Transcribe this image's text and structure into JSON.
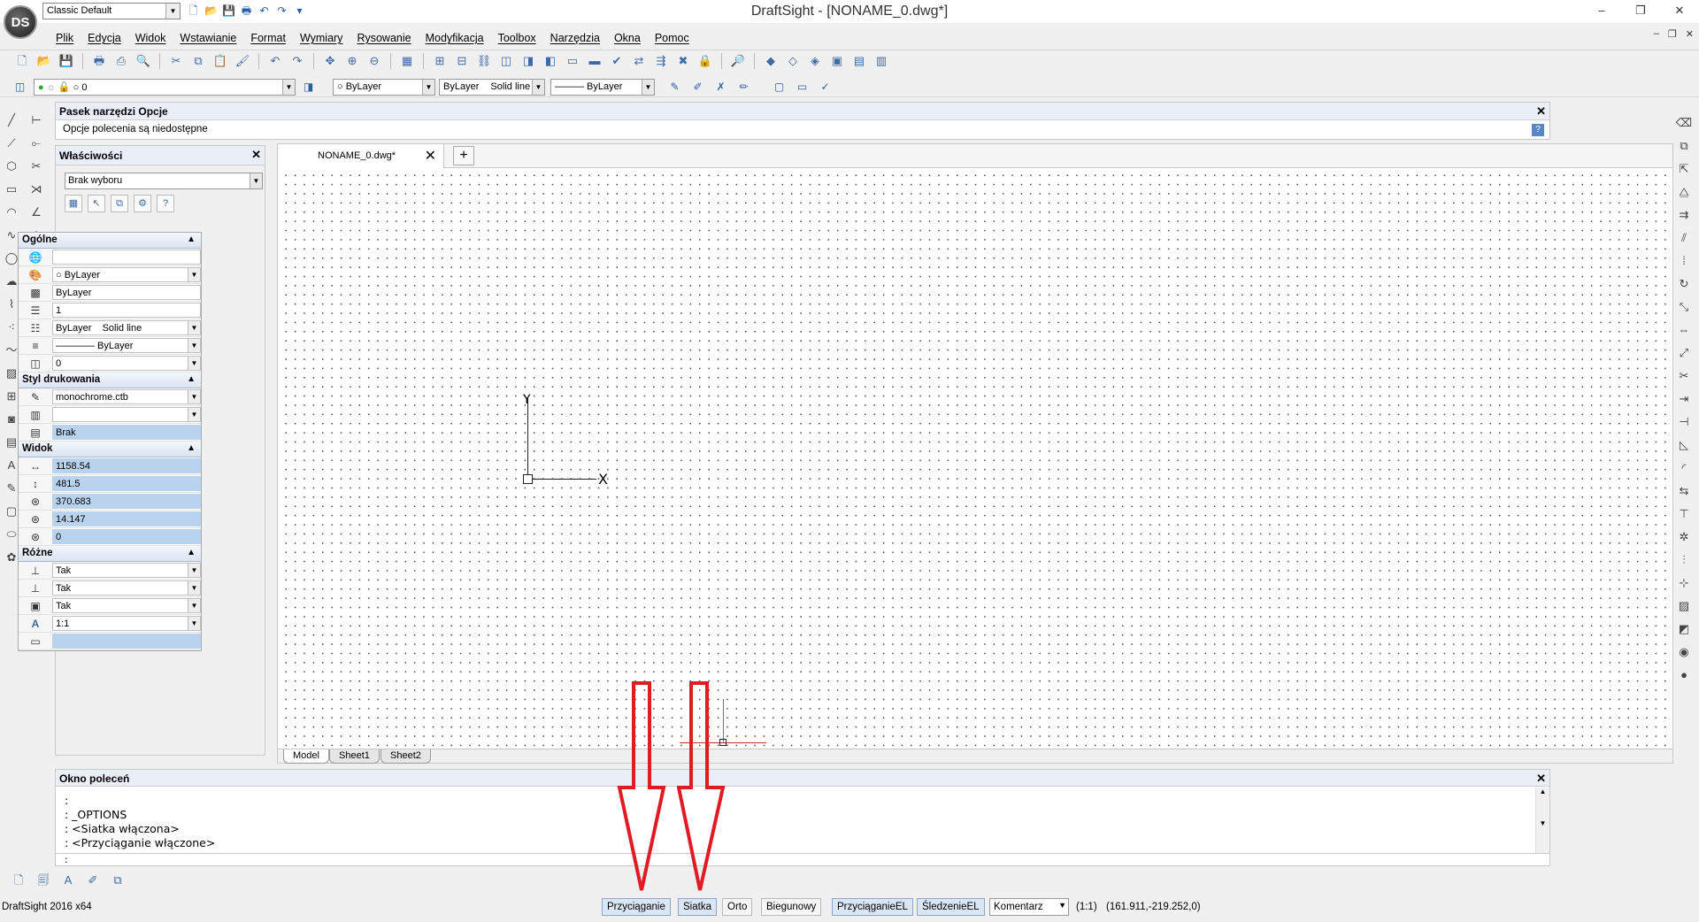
{
  "window": {
    "title": "DraftSight - [NONAME_0.dwg*]",
    "workspace": "Classic Default",
    "logo": "DS"
  },
  "window_controls": {
    "minimize": "–",
    "restore": "❐",
    "close": "✕"
  },
  "menu": [
    "Plik",
    "Edycja",
    "Widok",
    "Wstawianie",
    "Format",
    "Wymiary",
    "Rysowanie",
    "Modyfikacja",
    "Toolbox",
    "Narzędzia",
    "Okna",
    "Pomoc"
  ],
  "layer_toolbar": {
    "layer_name": "0",
    "color": "ByLayer",
    "linestyle_name": "ByLayer",
    "linestyle_desc": "Solid line",
    "lineweight": "——— ByLayer"
  },
  "options_bar": {
    "title": "Pasek narzędzi Opcje",
    "message": "Opcje polecenia są niedostępne"
  },
  "properties": {
    "title": "Właściwości",
    "selection": "Brak wyboru",
    "sections": {
      "general": {
        "title": "Ogólne",
        "color": "ByLayer",
        "color_text": "ByLayer",
        "scale": "1",
        "linestyle_name": "ByLayer",
        "linestyle_desc": "Solid line",
        "lineweight": "———— ByLayer",
        "layer": "0"
      },
      "print_style": {
        "title": "Styl drukowania",
        "table": "monochrome.ctb",
        "style": "Brak"
      },
      "view": {
        "title": "Widok",
        "values": [
          "1158.54",
          "481.5",
          "370.683",
          "14.147",
          "0"
        ]
      },
      "misc": {
        "title": "Różne",
        "values": [
          "Tak",
          "Tak",
          "Tak",
          "1:1"
        ]
      }
    }
  },
  "doc_tab": "NONAME_0.dwg*",
  "ucs": {
    "x": "X",
    "y": "Y"
  },
  "sheet_tabs": [
    "Model",
    "Sheet1",
    "Sheet2"
  ],
  "command_window": {
    "title": "Okno poleceń",
    "lines": [
      ":",
      ": _OPTIONS",
      ": <Siatka włączona>",
      ": <Przyciąganie włączone>",
      ":"
    ]
  },
  "status": {
    "app": "DraftSight 2016 x64",
    "buttons": [
      "Przyciąganie",
      "Siatka",
      "Orto",
      "Biegunowy",
      "PrzyciąganieEL",
      "ŚledzenieEL"
    ],
    "annotation": "Komentarz",
    "scale": "(1:1)",
    "coords": "(161.911,-219.252,0)"
  },
  "colors": {
    "accent": "#2b5ea8",
    "arrow": "#e01b24",
    "panel_header": "#e9eef7",
    "status_on": "#dbe6f5"
  }
}
